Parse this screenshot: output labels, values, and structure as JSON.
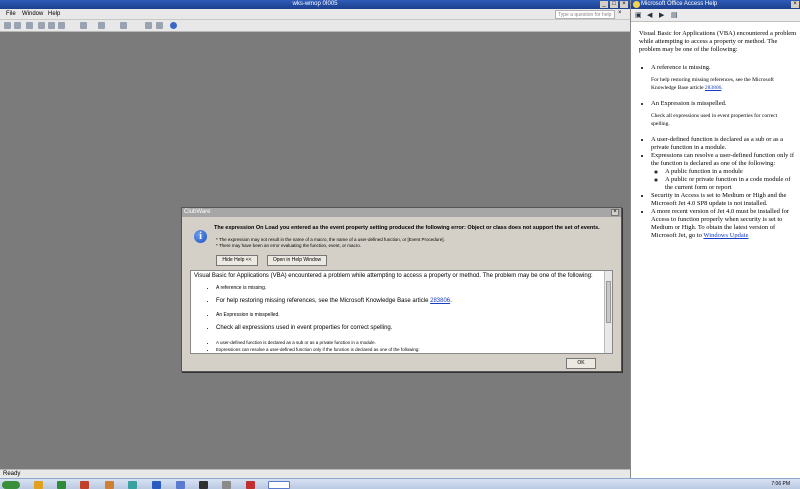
{
  "app": {
    "title": "wks-wmop 0Ï005",
    "menu": [
      "File",
      "Window",
      "Help"
    ],
    "help_question_placeholder": "Type a question for help",
    "status": "Ready"
  },
  "help_pane": {
    "title": "Microsoft Office Access Help",
    "intro": "Visual Basic for Applications (VBA) encountered a problem while attempting to access a property or method. The problem may be one of the following:",
    "item1": "A reference is missing.",
    "item1_detail_pre": "For help restoring missing references, see the Microsoft Knowledge Base article ",
    "item1_link": "283806",
    "item1_detail_post": ".",
    "item2": "An Expression is misspelled.",
    "item2_detail": "Check all expressions used in event properties for correct spelling.",
    "item3": "A user-defined function is declared as a sub or as a private function in a module.",
    "item4": "Expressions can resolve a user-defined function only if the function is declared as one of the following:",
    "item4_sub1": "A public function in a module",
    "item4_sub2": "A public or private function in a code module of the current form or report",
    "item5": "Security in Access is set to Medium or High and the Microsoft Jet 4.0 SP8 update is not installed.",
    "item6_pre": "A more recent version of Jet 4.0 must be installed for Access to function properly when security is set to Medium or High. To obtain the latest version of Microsoft Jet, go to ",
    "item6_link": "Windows Update"
  },
  "dialog": {
    "title": "ClubWare",
    "message": "The expression On Load you entered as the event property setting produced the following error: Object or class does not support the set of events.",
    "note1": "* The expression may not result in the name of a macro, the name of a user-defined function, or [Event Procedure].",
    "note2": "* There may have been an error evaluating the function, event, or macro.",
    "hide_help_label": "Hide Help <<",
    "open_help_label": "Open in Help Window",
    "ok_label": "OK",
    "details_intro": "Visual Basic for Applications (VBA) encountered a problem while attempting to access a property or method. The problem may be one of the following:",
    "d1": "A reference is missing.",
    "d2_pre": "For help restoring missing references, see the Microsoft Knowledge Base article ",
    "d2_link": "283806",
    "d2_post": ".",
    "d3": "An Expression is misspelled.",
    "d4": "Check all expressions used in event properties for correct spelling.",
    "d5": "A user-defined function is declared as a sub or as a private function in a module.",
    "d6": "Expressions can resolve a user-defined function only if the function is declared as one of the following:"
  },
  "taskbar": {
    "clock": "7:06 PM"
  },
  "colors": {
    "title_blue": "#2e5cb8",
    "workspace_gray": "#7b7b7b",
    "link_blue": "#1a3cc6"
  }
}
